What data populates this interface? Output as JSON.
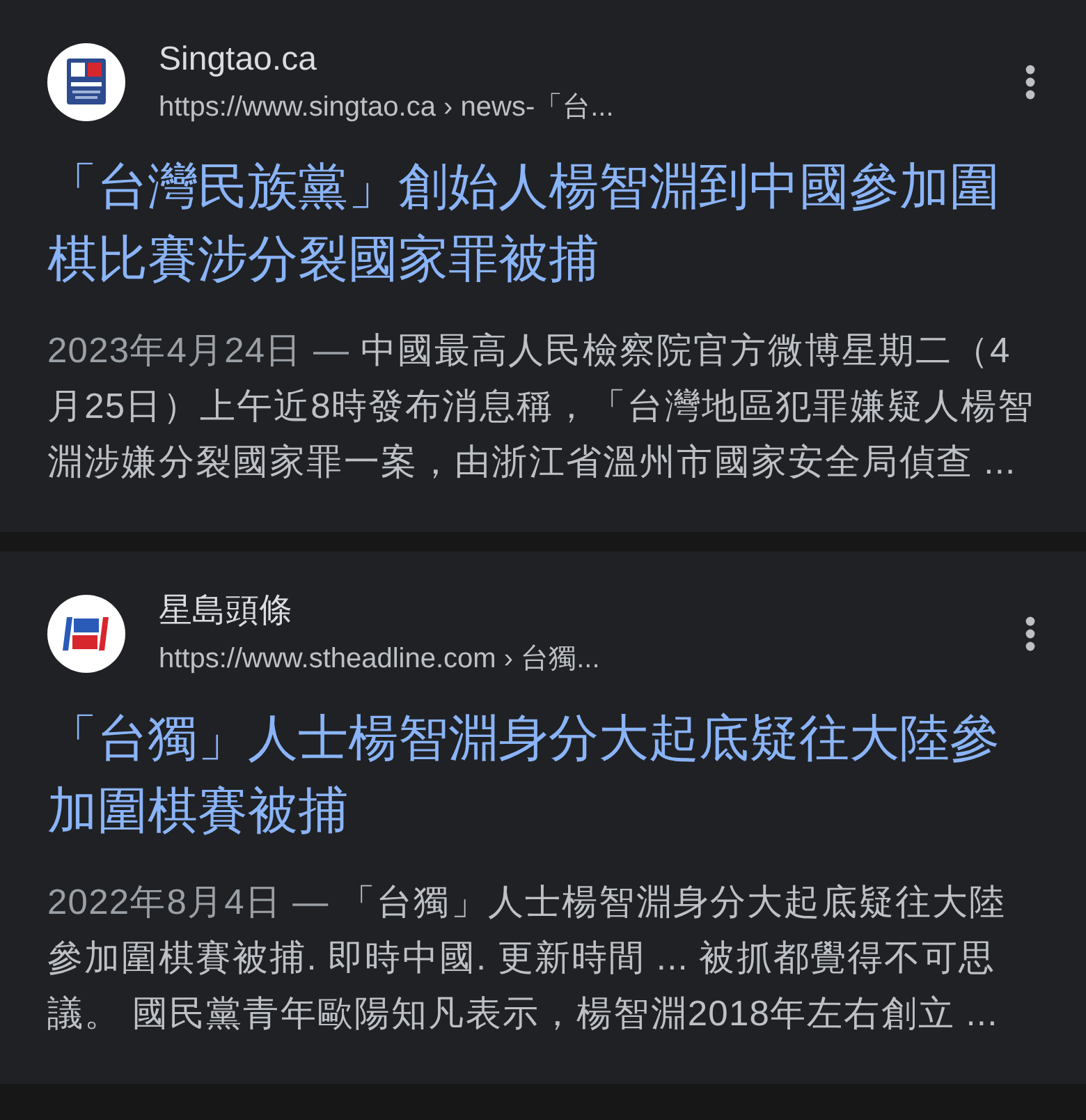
{
  "results": [
    {
      "kind": "singtao",
      "site": "Singtao.ca",
      "url": "https://www.singtao.ca › news-「台...",
      "title": "「台灣民族黨」創始人楊智淵到中國參加圍棋比賽涉分裂國家罪被捕",
      "date": "2023年4月24日 — ",
      "snippet": "中國最高人民檢察院官方微博星期二（4月25日）上午近8時發布消息稱，「台灣地區犯罪嫌疑人楊智淵涉嫌分裂國家罪一案，由浙江省溫州市國家安全局偵查 ..."
    },
    {
      "kind": "headline",
      "site": "星島頭條",
      "url": "https://www.stheadline.com › 台獨...",
      "title": "「台獨」人士楊智淵身分大起底疑往大陸參加圍棋賽被捕",
      "date": "2022年8月4日 — ",
      "snippet": "「台獨」人士楊智淵身分大起底疑往大陸參加圍棋賽被捕. 即時中國. 更新時間 ... 被抓都覺得不可思議。 國民黨青年歐陽知凡表示，楊智淵2018年左右創立 ..."
    }
  ]
}
